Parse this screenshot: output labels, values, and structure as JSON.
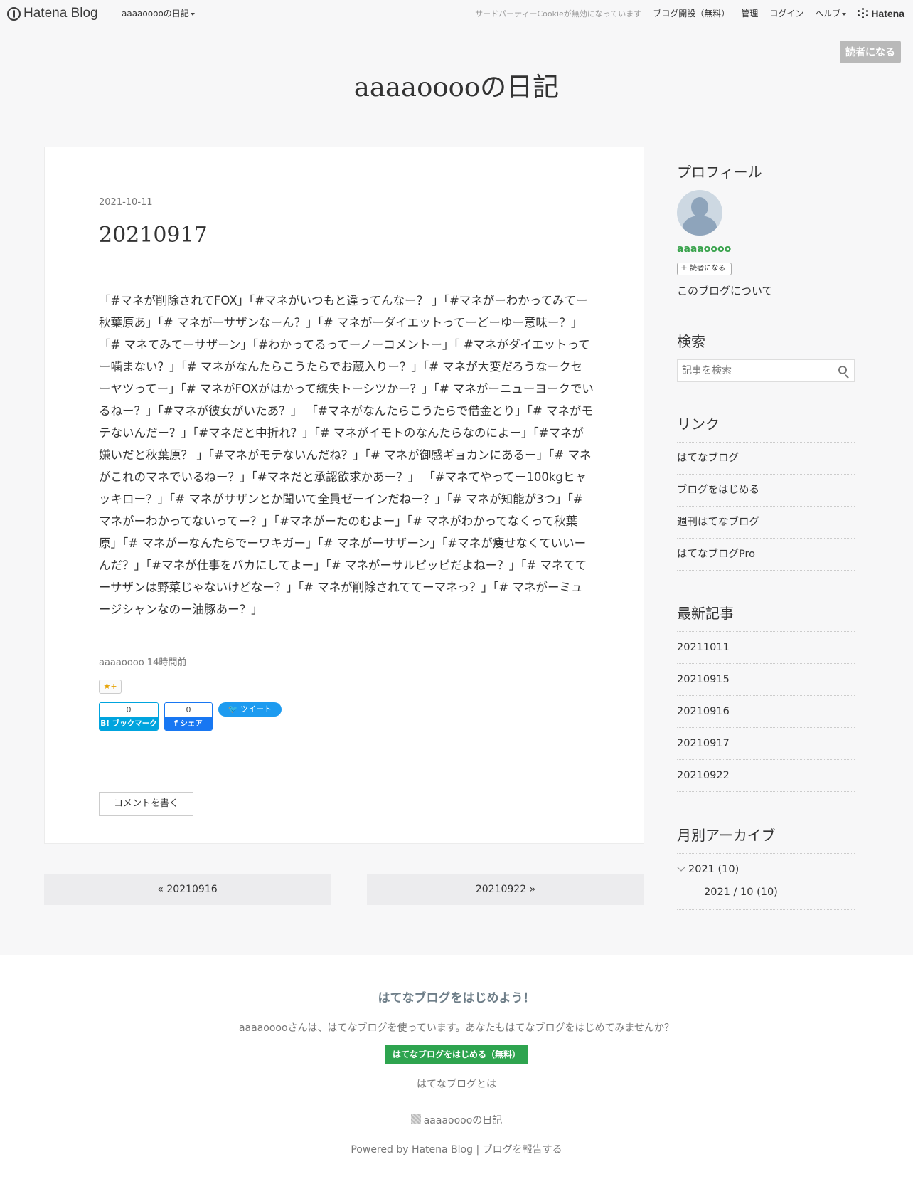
{
  "topbar": {
    "logo_text": "Hatena Blog",
    "blog_menu": "aaaaooooの日記",
    "cookie_notice": "サードパーティーCookieが無効になっています",
    "open_blog": "ブログ開設（無料）",
    "manage": "管理",
    "login": "ログイン",
    "help": "ヘルプ",
    "brand": "Hatena"
  },
  "subscribe_label": "読者になる",
  "blog_title": "aaaaooooの日記",
  "article": {
    "date": "2021-10-11",
    "title": "20210917",
    "body": "「#マネが削除されてFOX」「#マネがいつもと違ってんなー？ 」「#マネがーわかってみてー秋葉原あ」「# マネがーサザンなーん？」「# マネがーダイエットってーどーゆー意味ー？」「# マネてみてーサザーン」「#わかってるってーノーコメントー」「 #マネがダイエットってー噛まない？」「# マネがなんたらこうたらでお蔵入りー？」「# マネが大変だろうなークセーヤツってー」「# マネがFOXがはかって統失トーシツかー？」「# マネがーニューヨークでいるねー？」「#マネが彼女がいたあ？」 「#マネがなんたらこうたらで借金とり」「# マネがモテないんだー？」「#マネだと中折れ？」「# マネがイモトのなんたらなのによー」「#マネが嫌いだと秋葉原？ 」「#マネがモテないんだね？」「# マネが御感ギョカンにあるー」「# マネがこれのマネでいるねー？」「#マネだと承認欲求かあー？」 「#マネてやってー100kgヒャッキロー？」「# マネがサザンとか聞いて全員ゼーインだねー？」「# マネが知能が3つ」「#マネがーわかってないってー？」「#マネがーたのむよー」「# マネがわかってなくって秋葉原」「# マネがーなんたらでーワキガー」「# マネがーサザーン」「#マネが痩せなくていいーんだ？」「#マネが仕事をバカにしてよー」「# マネがーサルピッピだよねー？」「# マネててーサザンは野菜じゃないけどなー？」「# マネが削除されててーマネっ？」「# マネがーミュージシャンなのー油豚あー？」",
    "author_time": "aaaaoooo 14時間前",
    "star_label": "★+",
    "bookmark_count": "0",
    "bookmark_label": "B! ブックマーク",
    "fb_count": "0",
    "fb_label": "f シェア",
    "tweet_label": "ツイート",
    "comment_label": "コメントを書く"
  },
  "pager": {
    "prev": "« 20210916",
    "next": "20210922 »"
  },
  "sidebar": {
    "profile_title": "プロフィール",
    "profile_name": "aaaaoooo",
    "subscribe_small": "＋ 読者になる",
    "about": "このブログについて",
    "search_title": "検索",
    "search_placeholder": "記事を検索",
    "links_title": "リンク",
    "links": [
      "はてなブログ",
      "ブログをはじめる",
      "週刊はてなブログ",
      "はてなブログPro"
    ],
    "recent_title": "最新記事",
    "recent": [
      "20211011",
      "20210915",
      "20210916",
      "20210917",
      "20210922"
    ],
    "archive_title": "月別アーカイブ",
    "archive_year": "2021 (10)",
    "archive_month": "2021 / 10 (10)"
  },
  "footer": {
    "title": "はてなブログをはじめよう！",
    "desc": "aaaaooooさんは、はてなブログを使っています。あなたもはてなブログをはじめてみませんか？",
    "start_button": "はてなブログをはじめる（無料）",
    "about": "はてなブログとは",
    "blog_name": "aaaaooooの日記",
    "powered": "Powered by Hatena Blog",
    "separator": "|",
    "report": "ブログを報告する"
  }
}
